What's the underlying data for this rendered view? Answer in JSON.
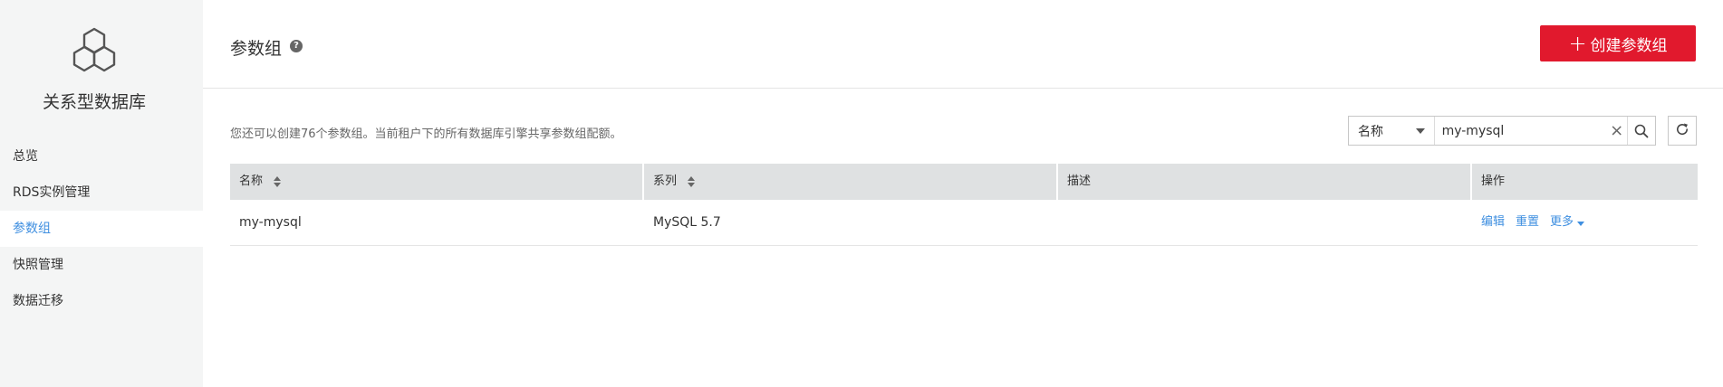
{
  "sidebar": {
    "service_name": "关系型数据库",
    "items": [
      {
        "label": "总览",
        "active": false
      },
      {
        "label": "RDS实例管理",
        "active": false
      },
      {
        "label": "参数组",
        "active": true
      },
      {
        "label": "快照管理",
        "active": false
      },
      {
        "label": "数据迁移",
        "active": false
      }
    ]
  },
  "header": {
    "title": "参数组",
    "help_icon": "question-circle-icon",
    "create_button_label": "创建参数组",
    "create_button_icon": "plus-icon",
    "create_button_color": "#e1192d"
  },
  "toolbar": {
    "quota_text": "您还可以创建76个参数组。当前租户下的所有数据库引擎共享参数组配额。",
    "search_field_selected": "名称",
    "search_value": "my-mysql",
    "clear_icon": "close-icon",
    "search_icon": "search-icon",
    "refresh_icon": "refresh-icon"
  },
  "table": {
    "headers": [
      "名称",
      "系列",
      "描述",
      "操作"
    ],
    "rows": [
      {
        "name": "my-mysql",
        "series": "MySQL 5.7",
        "description": "",
        "actions": [
          "编辑",
          "重置",
          "更多"
        ]
      }
    ]
  },
  "colors": {
    "accent": "#3f8fe0",
    "primary_button": "#e1192d",
    "sidebar_bg": "#f4f5f5",
    "table_header_bg": "#dfe1e2"
  }
}
